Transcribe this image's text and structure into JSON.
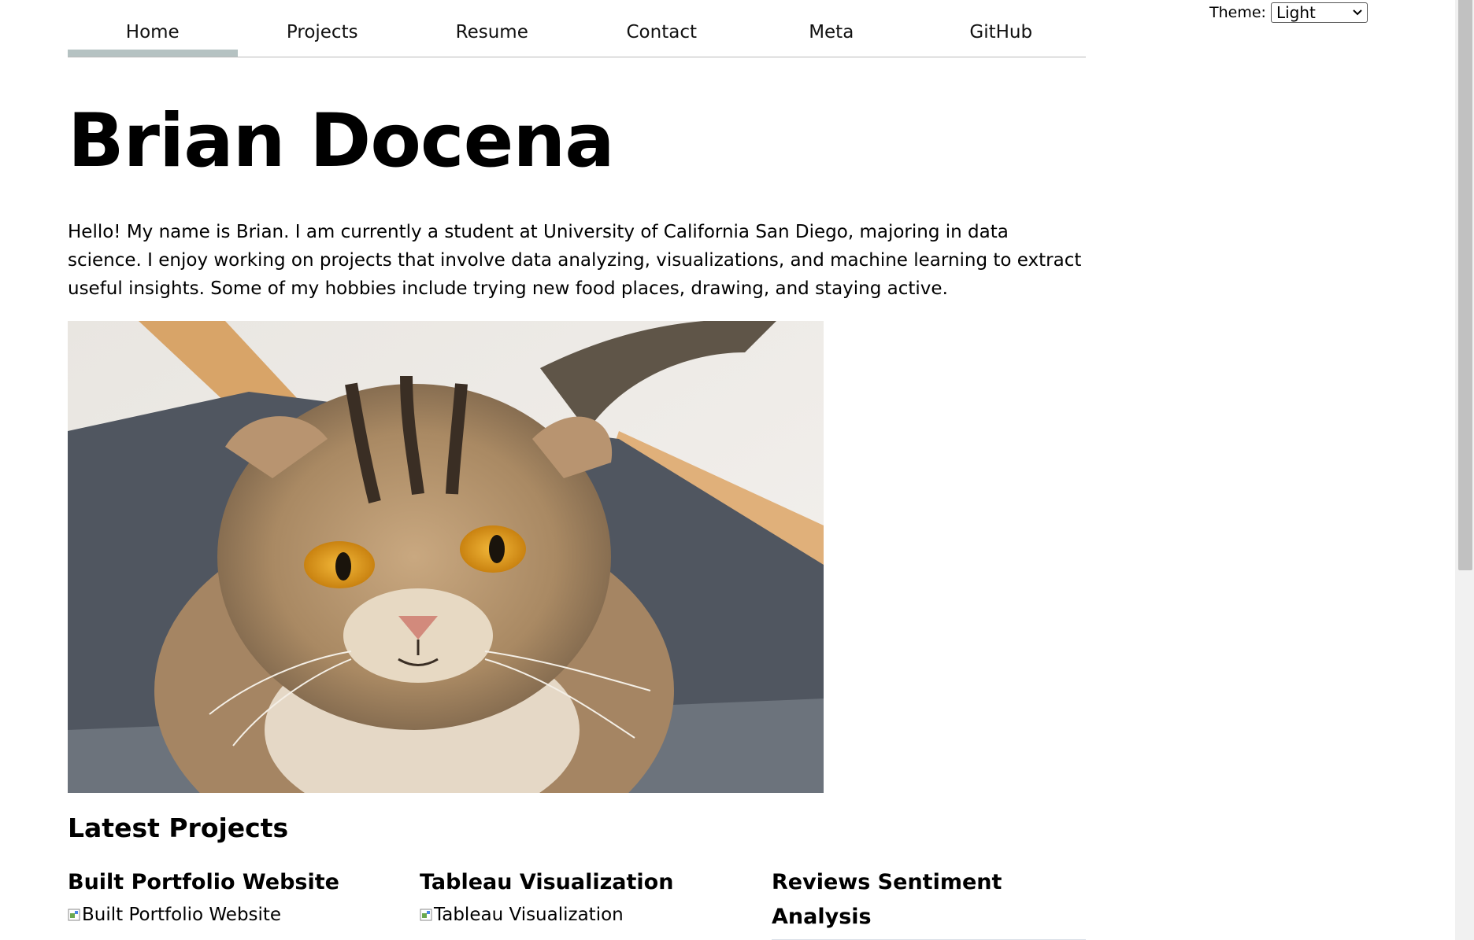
{
  "nav": {
    "items": [
      {
        "label": "Home",
        "current": true
      },
      {
        "label": "Projects"
      },
      {
        "label": "Resume"
      },
      {
        "label": "Contact"
      },
      {
        "label": "Meta"
      },
      {
        "label": "GitHub"
      }
    ]
  },
  "theme": {
    "label": "Theme:",
    "selected": "Light"
  },
  "header": {
    "title": "Brian Docena"
  },
  "intro": {
    "text": "Hello! My name is Brian. I am currently a student at University of California San Diego, majoring in data science. I enjoy working on projects that involve data analyzing, visualizations, and machine learning to extract useful insights. Some of my hobbies include trying new food places, drawing, and staying active."
  },
  "photo": {
    "icon": "cat-photo"
  },
  "latest": {
    "heading": "Latest Projects",
    "projects": [
      {
        "title": "Built Portfolio Website",
        "image_alt": "Built Portfolio Website"
      },
      {
        "title": "Tableau Visualization",
        "image_alt": "Tableau Visualization"
      },
      {
        "title": "Reviews Sentiment Analysis"
      }
    ]
  },
  "colors": {
    "nav_underline": "#b5c2c2",
    "image_placeholder": "#dae0e8"
  }
}
